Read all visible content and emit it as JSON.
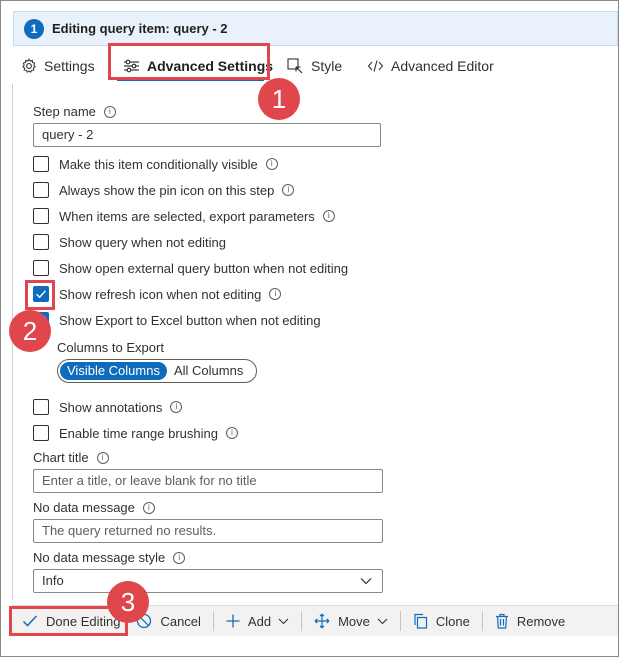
{
  "header": {
    "step_number": "1",
    "title": "Editing query item: query - 2"
  },
  "tabs": [
    {
      "label": "Settings",
      "icon": "gear-icon"
    },
    {
      "label": "Advanced Settings",
      "icon": "sliders-icon",
      "active": true
    },
    {
      "label": "Style",
      "icon": "style-icon"
    },
    {
      "label": "Advanced Editor",
      "icon": "code-icon"
    }
  ],
  "form": {
    "step_name_label": "Step name",
    "step_name_value": "query - 2",
    "checkboxes": [
      {
        "label": "Make this item conditionally visible",
        "checked": false,
        "info": true
      },
      {
        "label": "Always show the pin icon on this step",
        "checked": false,
        "info": true
      },
      {
        "label": "When items are selected, export parameters",
        "checked": false,
        "info": true
      },
      {
        "label": "Show query when not editing",
        "checked": false,
        "info": false
      },
      {
        "label": "Show open external query button when not editing",
        "checked": false,
        "info": false
      },
      {
        "label": "Show refresh icon when not editing",
        "checked": true,
        "info": true
      },
      {
        "label": "Show Export to Excel button when not editing",
        "checked": true,
        "info": false
      }
    ],
    "columns_to_export_label": "Columns to Export",
    "columns_options": [
      "Visible Columns",
      "All Columns"
    ],
    "columns_selected": "Visible Columns",
    "checkboxes2": [
      {
        "label": "Show annotations",
        "checked": false,
        "info": true
      },
      {
        "label": "Enable time range brushing",
        "checked": false,
        "info": true
      }
    ],
    "chart_title_label": "Chart title",
    "chart_title_placeholder": "Enter a title, or leave blank for no title",
    "no_data_message_label": "No data message",
    "no_data_message_placeholder": "The query returned no results.",
    "no_data_style_label": "No data message style",
    "no_data_style_value": "Info"
  },
  "toolbar": {
    "done_label": "Done Editing",
    "cancel_label": "Cancel",
    "add_label": "Add",
    "move_label": "Move",
    "clone_label": "Clone",
    "remove_label": "Remove"
  },
  "callouts": [
    "1",
    "2",
    "3"
  ],
  "colors": {
    "accent": "#0f6cbd",
    "callout": "#e0474c",
    "header_bg": "#e9f2fb"
  }
}
